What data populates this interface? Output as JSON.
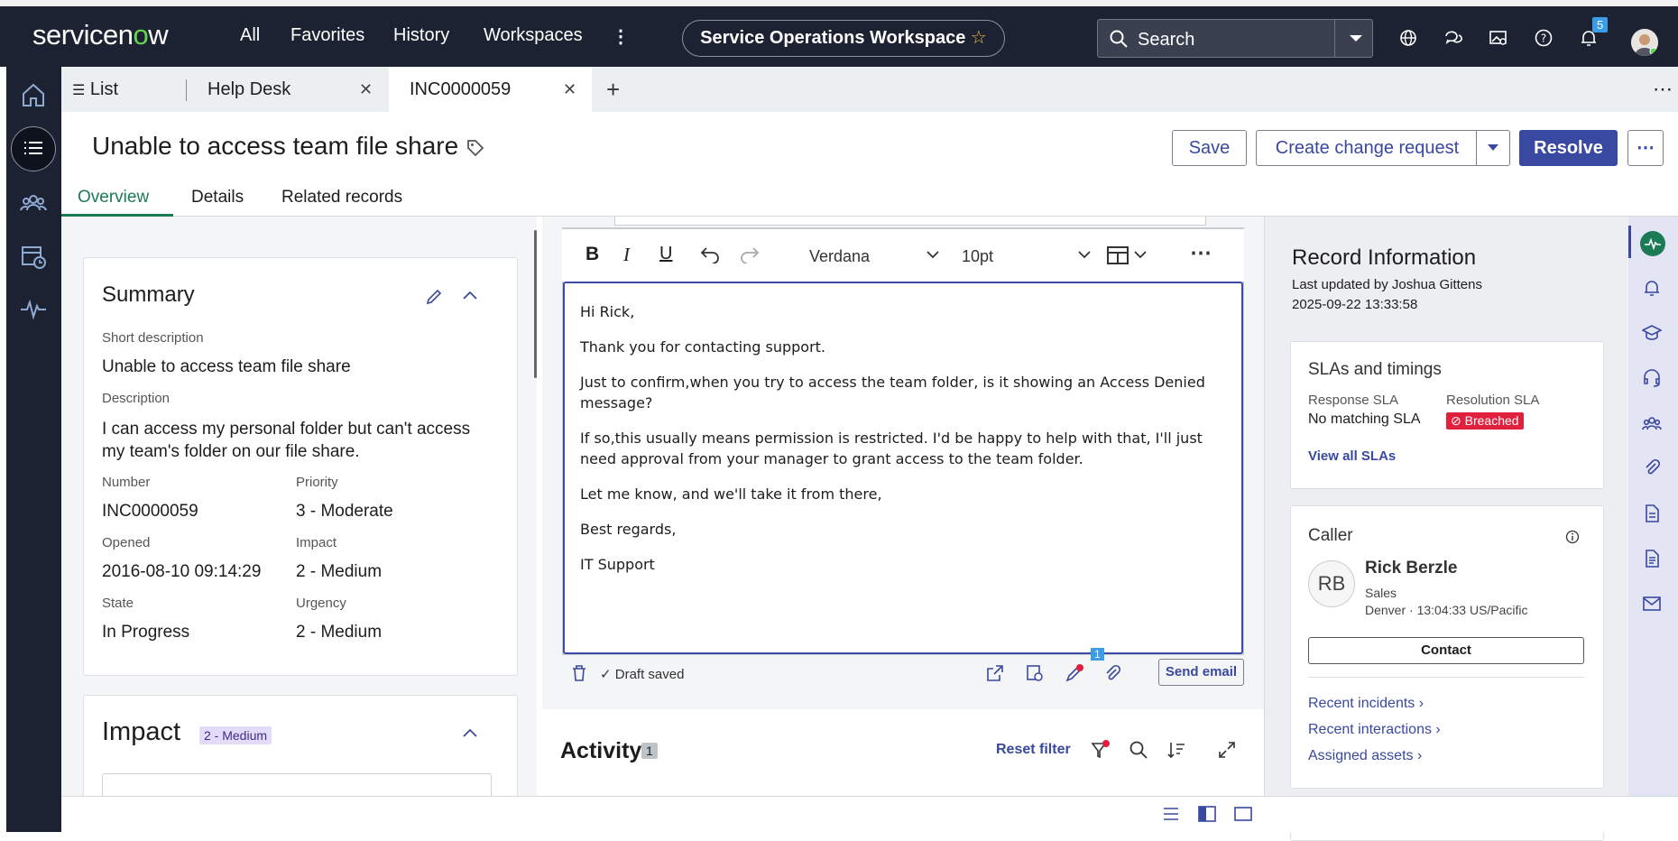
{
  "topnav": {
    "logo_a": "servicen",
    "logo_o": "o",
    "logo_b": "w",
    "all": "All",
    "favorites": "Favorites",
    "history": "History",
    "workspaces": "Workspaces",
    "workspace_name": "Service Operations Workspace",
    "search_placeholder": "Search",
    "notif_count": "5"
  },
  "tabs": {
    "list": "List",
    "helpdesk": "Help Desk",
    "incident": "INC0000059",
    "add": "+"
  },
  "header": {
    "title": "Unable to access team file share",
    "save": "Save",
    "create_change": "Create change request",
    "resolve": "Resolve"
  },
  "subtabs": {
    "overview": "Overview",
    "details": "Details",
    "related": "Related records"
  },
  "summary": {
    "heading": "Summary",
    "short_desc_label": "Short description",
    "short_desc": "Unable to access team file share",
    "desc_label": "Description",
    "desc": "I can access my personal folder but can't access my team's folder on our file share.",
    "number_label": "Number",
    "number": "INC0000059",
    "priority_label": "Priority",
    "priority": "3 - Moderate",
    "opened_label": "Opened",
    "opened": "2016-08-10 09:14:29",
    "impact_label": "Impact",
    "impact": "2 - Medium",
    "state_label": "State",
    "state": "In Progress",
    "urgency_label": "Urgency",
    "urgency": "2 - Medium"
  },
  "impact_card": {
    "heading": "Impact",
    "badge": "2 - Medium"
  },
  "editor": {
    "font": "Verdana",
    "size": "10pt",
    "lines": [
      "Hi Rick,",
      "Thank you for contacting support.",
      "Just to confirm,when you try to access the team folder, is it showing an Access Denied message?",
      "If so,this usually means permission is restricted. I'd be happy to help with that, I'll just need approval from your manager to grant access to the team folder.",
      "Let me know, and we'll take it from there,",
      "Best regards,",
      "IT Support"
    ],
    "draft": "Draft saved",
    "send": "Send email",
    "tpl_count": "1"
  },
  "activity": {
    "heading": "Activity",
    "count": "1",
    "reset": "Reset filter"
  },
  "record_info": {
    "heading": "Record Information",
    "updated_by": "Last updated by Joshua Gittens",
    "updated_at": "2025-09-22 13:33:58"
  },
  "sla": {
    "heading": "SLAs and timings",
    "response_label": "Response SLA",
    "response_val": "No matching SLA",
    "resolution_label": "Resolution SLA",
    "resolution_val": "Breached",
    "view_all": "View all SLAs"
  },
  "caller": {
    "heading": "Caller",
    "initials": "RB",
    "name": "Rick Berzle",
    "dept": "Sales",
    "location": "Denver · 13:04:33 US/Pacific",
    "contact": "Contact",
    "recent_incidents": "Recent incidents",
    "recent_interactions": "Recent interactions",
    "assigned_assets": "Assigned assets"
  },
  "colors": {
    "topbar": "#1c2232",
    "accent": "#3948a0",
    "breached": "#e0203c",
    "active_tab_line": "#1a7b55"
  }
}
